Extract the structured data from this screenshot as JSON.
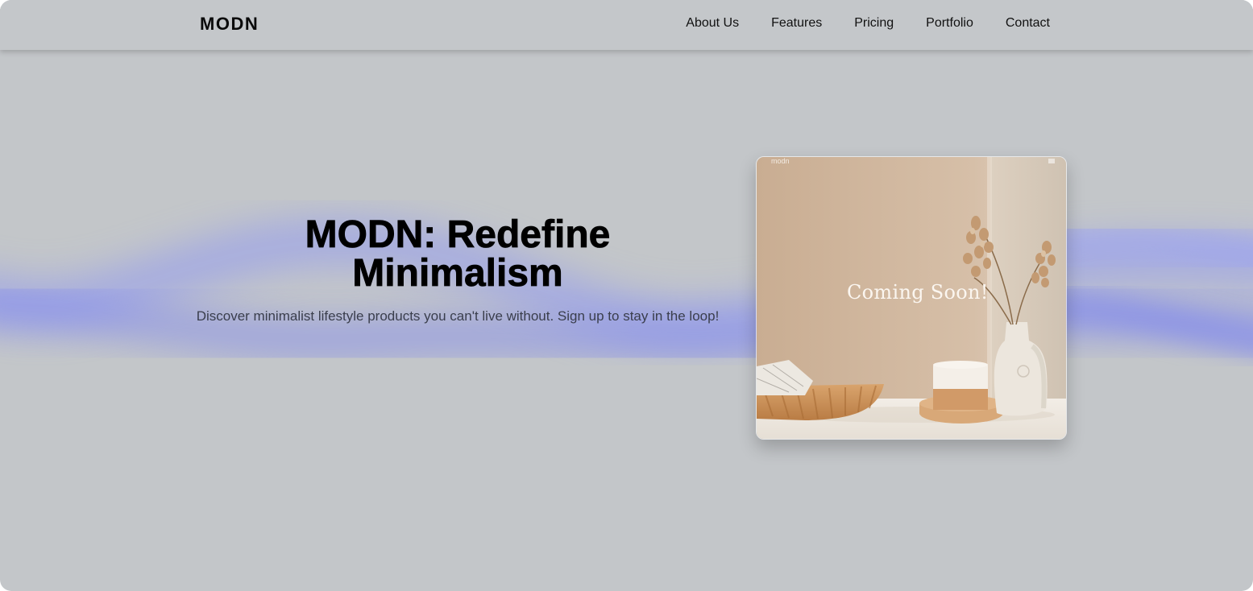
{
  "brand": {
    "logo": "MODN"
  },
  "nav": {
    "items": [
      {
        "label": "About Us"
      },
      {
        "label": "Features"
      },
      {
        "label": "Pricing"
      },
      {
        "label": "Portfolio"
      },
      {
        "label": "Contact"
      }
    ]
  },
  "hero": {
    "title_line1": "MODN: Redefine",
    "title_line2": "Minimalism",
    "subtitle": "Discover minimalist lifestyle products you can't live without. Sign up to stay in the loop!"
  },
  "preview": {
    "mini_logo": "modn",
    "overlay_text": "Coming Soon!"
  },
  "colors": {
    "background": "#c3c6c9",
    "wave": "#8a92f0",
    "text": "#000000",
    "subtitle": "#3a3e4c"
  }
}
